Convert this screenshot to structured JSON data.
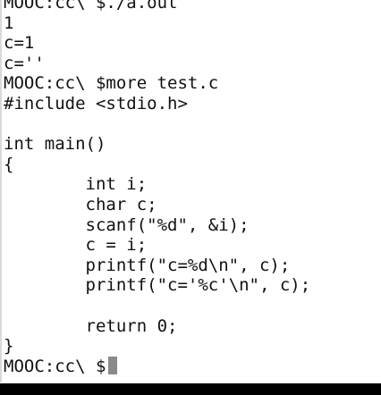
{
  "terminal": {
    "lines": [
      "MOOC:cc\\ $./a.out",
      "1",
      "c=1",
      "c=''",
      "MOOC:cc\\ $more test.c",
      "#include <stdio.h>",
      "",
      "int main()",
      "{",
      "        int i;",
      "        char c;",
      "        scanf(\"%d\", &i);",
      "        c = i;",
      "        printf(\"c=%d\\n\", c);",
      "        printf(\"c='%c'\\n\", c);",
      "",
      "        return 0;",
      "}",
      "MOOC:cc\\ $"
    ]
  }
}
